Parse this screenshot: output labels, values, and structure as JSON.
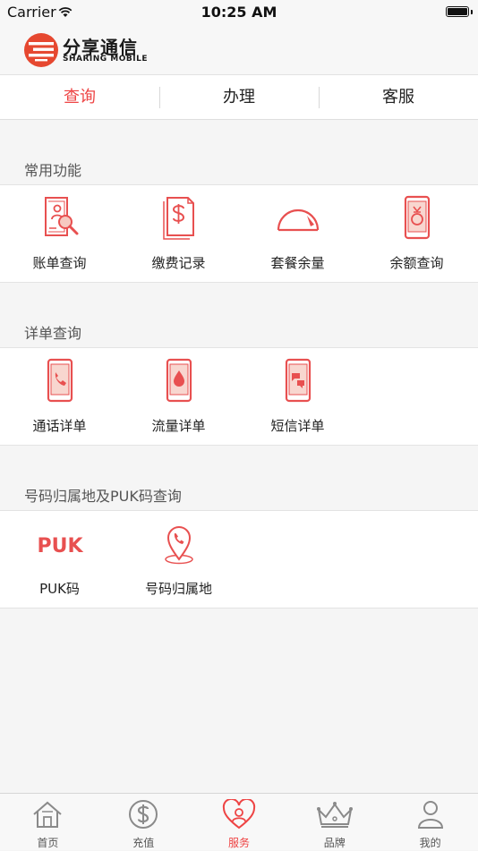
{
  "status_bar": {
    "carrier": "Carrier",
    "time": "10:25 AM"
  },
  "brand": {
    "name_cn": "分享通信",
    "name_en": "SHARING MOBILE"
  },
  "tabs": [
    {
      "label": "查询",
      "active": true
    },
    {
      "label": "办理",
      "active": false
    },
    {
      "label": "客服",
      "active": false
    }
  ],
  "sections": [
    {
      "title": "常用功能",
      "items": [
        {
          "label": "账单查询",
          "icon": "bill-search-icon"
        },
        {
          "label": "缴费记录",
          "icon": "payment-record-icon"
        },
        {
          "label": "套餐余量",
          "icon": "gauge-icon"
        },
        {
          "label": "余额查询",
          "icon": "phone-balance-icon"
        }
      ]
    },
    {
      "title": "详单查询",
      "items": [
        {
          "label": "通话详单",
          "icon": "phone-call-icon"
        },
        {
          "label": "流量详单",
          "icon": "phone-data-icon"
        },
        {
          "label": "短信详单",
          "icon": "phone-sms-icon"
        }
      ]
    },
    {
      "title": "号码归属地及PUK码查询",
      "items": [
        {
          "label": "PUK码",
          "icon": "puk-icon",
          "icon_text": "PUK"
        },
        {
          "label": "号码归属地",
          "icon": "location-pin-icon"
        }
      ]
    }
  ],
  "bottom_nav": [
    {
      "label": "首页",
      "icon": "home-icon",
      "active": false
    },
    {
      "label": "充值",
      "icon": "dollar-coin-icon",
      "active": false
    },
    {
      "label": "服务",
      "icon": "heart-user-icon",
      "active": true
    },
    {
      "label": "品牌",
      "icon": "crown-icon",
      "active": false
    },
    {
      "label": "我的",
      "icon": "user-icon",
      "active": false
    }
  ],
  "colors": {
    "accent": "#ee4444",
    "icon_red": "#e85050",
    "nav_gray": "#8a8a8a"
  }
}
